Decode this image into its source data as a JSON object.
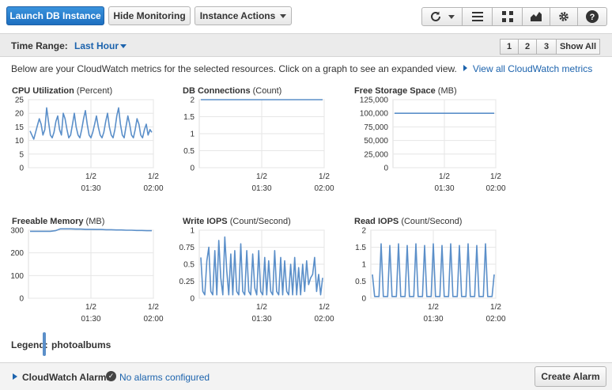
{
  "toolbar": {
    "launch_label": "Launch DB Instance",
    "hide_monitoring_label": "Hide Monitoring",
    "instance_actions_label": "Instance Actions",
    "icons": [
      "refresh-icon",
      "list-icon",
      "grid-icon",
      "chart-icon",
      "gear-icon",
      "help-icon"
    ]
  },
  "time_range": {
    "label": "Time Range:",
    "value": "Last Hour",
    "pages": [
      "1",
      "2",
      "3"
    ],
    "show_all_label": "Show All"
  },
  "info": {
    "text": "Below are your CloudWatch metrics for the selected resources. Click on a graph to see an expanded view.",
    "link": "View all CloudWatch metrics"
  },
  "chart_data": [
    {
      "type": "line",
      "title": "CPU Utilization",
      "unit": "(Percent)",
      "yticks": [
        "25",
        "20",
        "15",
        "10",
        "5",
        "0"
      ],
      "ylim": [
        0,
        25
      ],
      "xticks": [
        [
          "1/2",
          "01:30"
        ],
        [
          "1/2",
          "02:00"
        ]
      ],
      "series": [
        {
          "color": "#5b8fc9",
          "values": [
            13.5,
            12,
            10.5,
            13,
            15.5,
            18,
            16,
            12,
            14,
            22,
            17,
            12,
            11,
            13,
            17,
            19,
            14,
            12,
            20,
            18,
            14,
            11,
            12,
            16,
            20,
            15,
            12,
            11,
            14,
            18,
            21,
            16,
            12,
            11,
            13,
            16,
            19,
            15,
            12,
            11,
            13,
            17,
            20,
            15,
            12,
            11,
            14,
            19,
            22,
            16,
            12,
            11,
            15,
            19,
            16,
            12,
            11,
            14,
            18,
            16,
            12,
            11,
            14,
            16,
            12,
            14,
            13
          ]
        }
      ]
    },
    {
      "type": "line",
      "title": "DB Connections",
      "unit": "(Count)",
      "yticks": [
        "2",
        "1.5",
        "1",
        "0.5",
        "0"
      ],
      "ylim": [
        0,
        2
      ],
      "xticks": [
        [
          "1/2",
          "01:30"
        ],
        [
          "1/2",
          "02:00"
        ]
      ],
      "series": [
        {
          "color": "#5b8fc9",
          "values": [
            2,
            2
          ]
        }
      ]
    },
    {
      "type": "line",
      "title": "Free Storage Space",
      "unit": "(MB)",
      "yticks": [
        "125,000",
        "100,000",
        "75,000",
        "50,000",
        "25,000",
        "0"
      ],
      "ylim": [
        0,
        125000
      ],
      "xticks": [
        [
          "1/2",
          "01:30"
        ],
        [
          "1/2",
          "02:00"
        ]
      ],
      "series": [
        {
          "color": "#5b8fc9",
          "values": [
            100000,
            100000
          ]
        }
      ]
    },
    {
      "type": "line",
      "title": "Freeable Memory",
      "unit": "(MB)",
      "yticks": [
        "300",
        "200",
        "100",
        "0"
      ],
      "ylim": [
        0,
        300
      ],
      "xticks": [
        [
          "1/2",
          "01:30"
        ],
        [
          "1/2",
          "02:00"
        ]
      ],
      "series": [
        {
          "color": "#5b8fc9",
          "values": [
            295,
            295,
            295,
            295,
            295,
            298,
            306,
            306,
            306,
            305,
            305,
            304,
            304,
            303,
            303,
            302,
            302,
            301,
            301,
            300,
            300,
            299,
            299,
            298,
            298
          ]
        }
      ]
    },
    {
      "type": "line",
      "title": "Write IOPS",
      "unit": "(Count/Second)",
      "yticks": [
        "1",
        "0.75",
        "0.5",
        "0.25",
        "0"
      ],
      "ylim": [
        0,
        1
      ],
      "xticks": [
        [
          "1/2",
          "01:30"
        ],
        [
          "1/2",
          "02:00"
        ]
      ],
      "series": [
        {
          "color": "#5b8fc9",
          "values": [
            0.6,
            0.1,
            0.05,
            0.55,
            0.75,
            0.1,
            0.05,
            0.7,
            0.05,
            0.85,
            0.3,
            0.05,
            0.9,
            0.4,
            0.05,
            0.65,
            0.05,
            0.7,
            0.1,
            0.05,
            0.8,
            0.1,
            0.05,
            0.7,
            0.1,
            0.05,
            0.65,
            0.15,
            0.05,
            0.7,
            0.1,
            0.05,
            0.6,
            0.05,
            0.55,
            0.1,
            0.05,
            0.7,
            0.1,
            0.05,
            0.6,
            0.05,
            0.55,
            0.1,
            0.05,
            0.5,
            0.05,
            0.6,
            0.05,
            0.45,
            0.05,
            0.5,
            0.1,
            0.55,
            0.2,
            0.3,
            0.35,
            0.6,
            0.1,
            0.35,
            0.05,
            0.3
          ]
        }
      ]
    },
    {
      "type": "line",
      "title": "Read IOPS",
      "unit": "(Count/Second)",
      "yticks": [
        "2",
        "1.5",
        "1",
        "0.5",
        "0"
      ],
      "ylim": [
        0,
        2
      ],
      "xticks": [
        [
          "1/2",
          "01:30"
        ],
        [
          "1/2",
          "02:00"
        ]
      ],
      "series": [
        {
          "color": "#5b8fc9",
          "values": [
            0.7,
            0.05,
            0.05,
            0.05,
            1.6,
            0.05,
            0.05,
            0.05,
            1.55,
            0.05,
            0.05,
            0.05,
            1.6,
            0.05,
            0.05,
            0.05,
            1.55,
            0.05,
            0.05,
            0.05,
            1.6,
            0.05,
            0.05,
            0.05,
            1.55,
            0.05,
            0.05,
            0.05,
            1.6,
            0.05,
            0.05,
            0.05,
            1.55,
            0.05,
            0.05,
            0.05,
            1.6,
            0.05,
            0.05,
            0.05,
            1.55,
            0.05,
            0.05,
            0.05,
            1.6,
            0.05,
            0.05,
            0.05,
            1.55,
            0.05,
            0.05,
            0.05,
            1.6,
            0.05,
            0.05,
            0.05,
            0.7
          ]
        }
      ]
    }
  ],
  "legend": {
    "label": "Legend:",
    "series_name": "photoalbums",
    "color": "#5b8fc9"
  },
  "alarms": {
    "label": "CloudWatch Alarms:",
    "status": "No alarms configured",
    "create_label": "Create Alarm"
  }
}
